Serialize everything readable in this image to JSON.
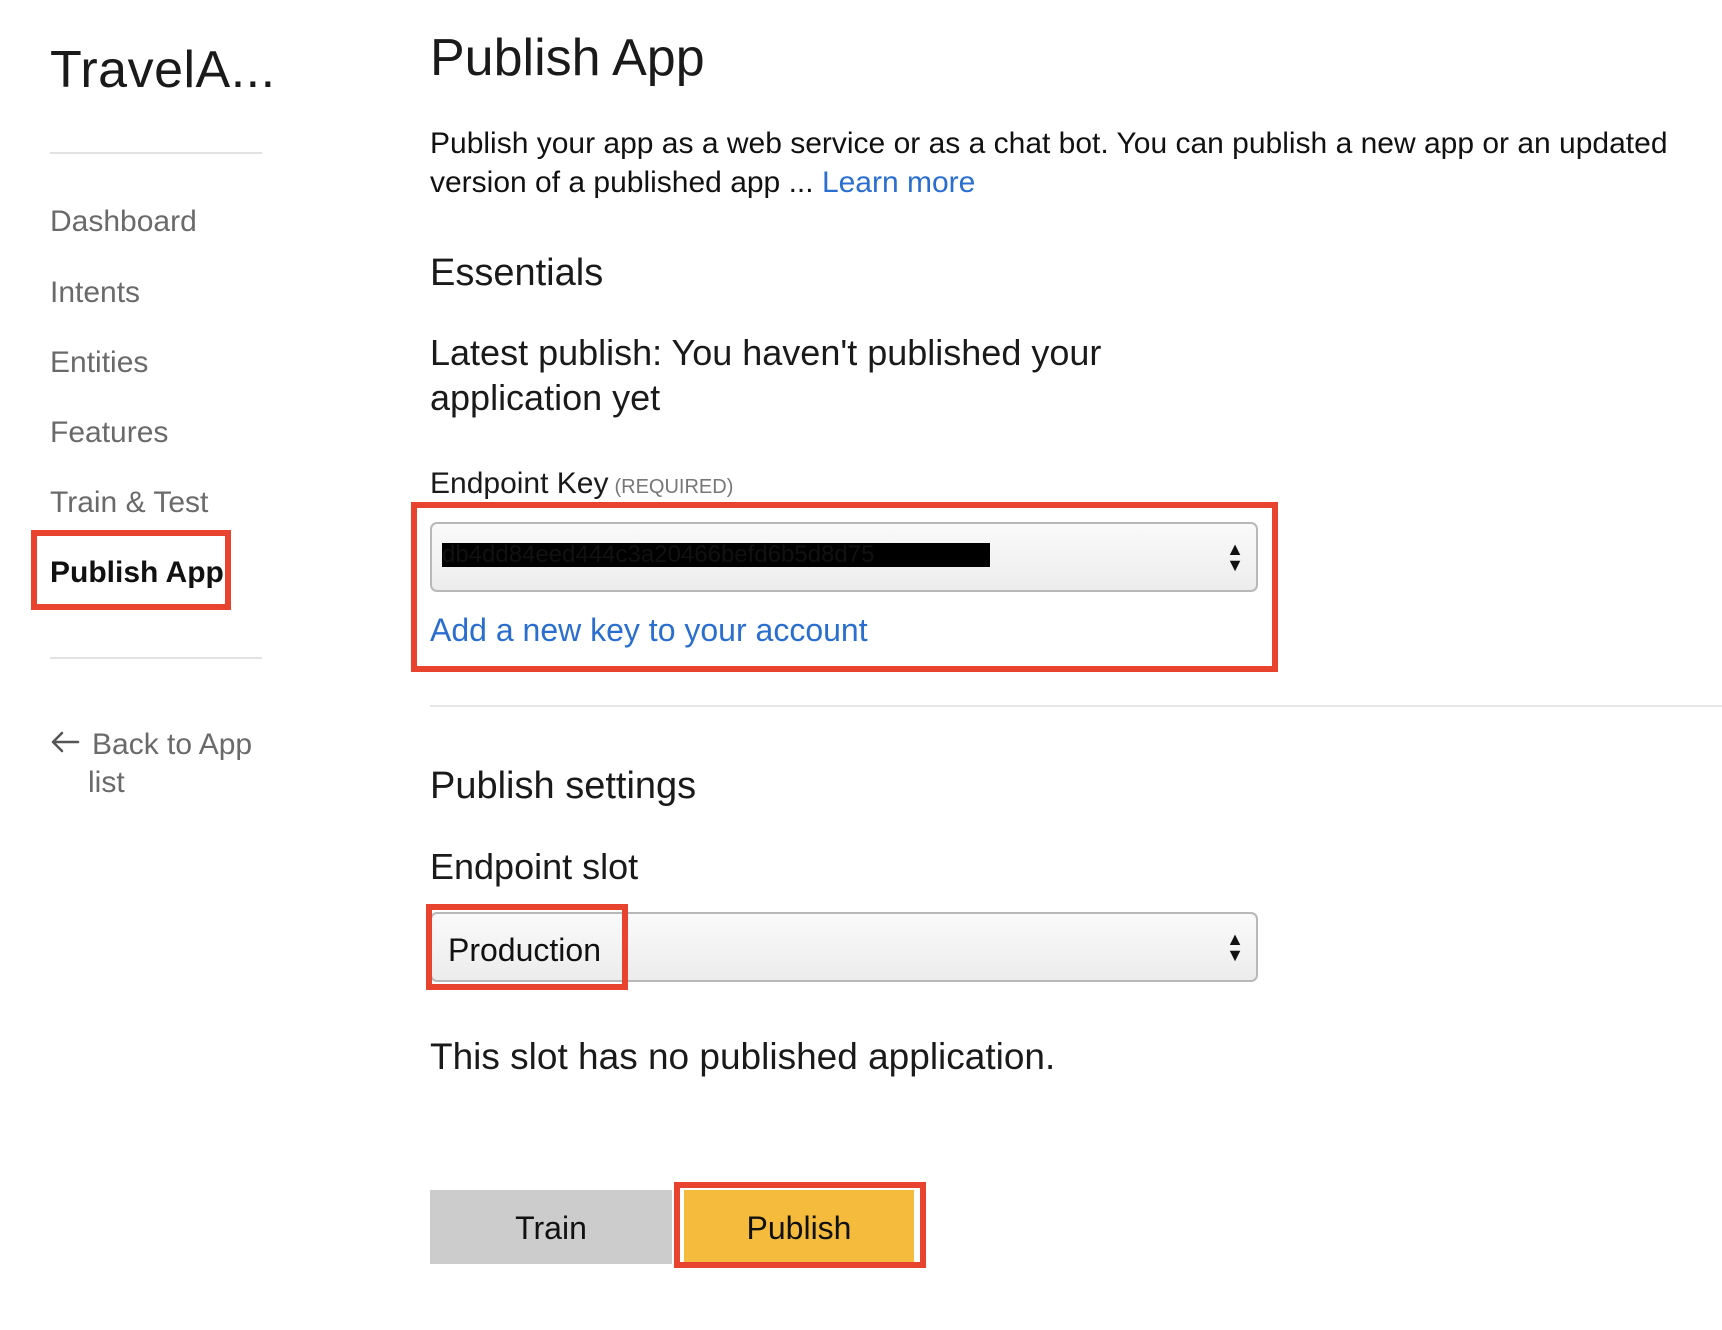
{
  "sidebar": {
    "app_title": "TravelA...",
    "items": [
      {
        "label": "Dashboard"
      },
      {
        "label": "Intents"
      },
      {
        "label": "Entities"
      },
      {
        "label": "Features"
      },
      {
        "label": "Train & Test"
      },
      {
        "label": "Publish App",
        "active": true
      }
    ],
    "back_link": {
      "line1": "Back to App",
      "line2": "list",
      "icon": "arrow-left-icon"
    }
  },
  "main": {
    "title": "Publish App",
    "intro_text": "Publish your app as a web service or as a chat bot. You can publish a new app or an updated version of a published app ...",
    "learn_more": "Learn more",
    "essentials": {
      "heading": "Essentials",
      "latest_publish": "Latest publish: You haven't published your application yet",
      "endpoint_key_label": "Endpoint Key",
      "endpoint_key_required": "(REQUIRED)",
      "endpoint_key_value": "db4dd84eed444c3a20466befd6b5d8d75",
      "add_key_link": "Add a new key to your account"
    },
    "publish_settings": {
      "heading": "Publish settings",
      "endpoint_slot_label": "Endpoint slot",
      "endpoint_slot_value": "Production",
      "slot_note": "This slot has no published application."
    },
    "buttons": {
      "train": "Train",
      "publish": "Publish"
    }
  },
  "colors": {
    "highlight": "#e8432e",
    "link": "#2a6fcf",
    "publish_button": "#f4bb3c",
    "train_button": "#cccccc"
  }
}
